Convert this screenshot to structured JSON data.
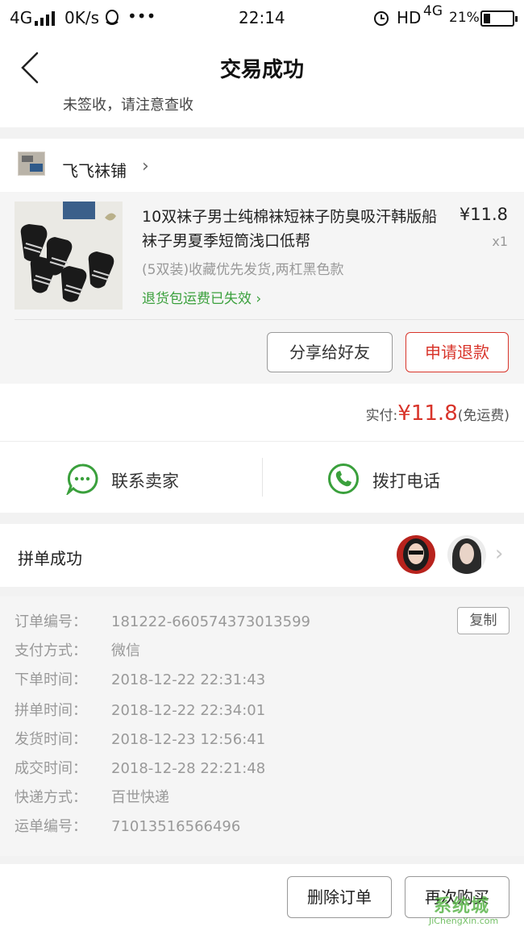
{
  "status_bar": {
    "network": "4G",
    "speed": "0K/s",
    "more": "•••",
    "time": "22:14",
    "hd": "HD",
    "network2": "4G",
    "battery": "21%"
  },
  "nav": {
    "title": "交易成功"
  },
  "address_cut": "未签收，请注意查收",
  "shop": {
    "name": "飞飞袜铺"
  },
  "product": {
    "title": "10双袜子男士纯棉袜短袜子防臭吸汗韩版船袜子男夏季短筒浅口低帮",
    "price": "¥11.8",
    "qty": "x1",
    "spec": "(5双装)收藏优先发货,两杠黑色款",
    "return_notice": "退货包运费已失效",
    "share_label": "分享给好友",
    "refund_label": "申请退款"
  },
  "payment": {
    "label": "实付:",
    "amount": "¥11.8",
    "note": "(免运费)"
  },
  "contact": {
    "chat_label": "联系卖家",
    "call_label": "拨打电话"
  },
  "group": {
    "label": "拼单成功"
  },
  "order": {
    "copy_label": "复制",
    "rows": [
      {
        "label": "订单编号：",
        "value": "181222-660574373013599"
      },
      {
        "label": "支付方式：",
        "value": "微信"
      },
      {
        "label": "下单时间：",
        "value": "2018-12-22 22:31:43"
      },
      {
        "label": "拼单时间：",
        "value": "2018-12-22 22:34:01"
      },
      {
        "label": "发货时间：",
        "value": "2018-12-23 12:56:41"
      },
      {
        "label": "成交时间：",
        "value": "2018-12-28 22:21:48"
      },
      {
        "label": "快递方式：",
        "value": "百世快递"
      },
      {
        "label": "运单编号：",
        "value": "71013516566496"
      }
    ]
  },
  "actions": {
    "delete_label": "删除订单",
    "rebuy_label": "再次购买"
  },
  "watermark": {
    "logo": "系统城",
    "url": "JiChengXin.com"
  },
  "colors": {
    "accent_red": "#d8342a",
    "green": "#3aa03c",
    "bg_gray": "#f2f2f2"
  }
}
